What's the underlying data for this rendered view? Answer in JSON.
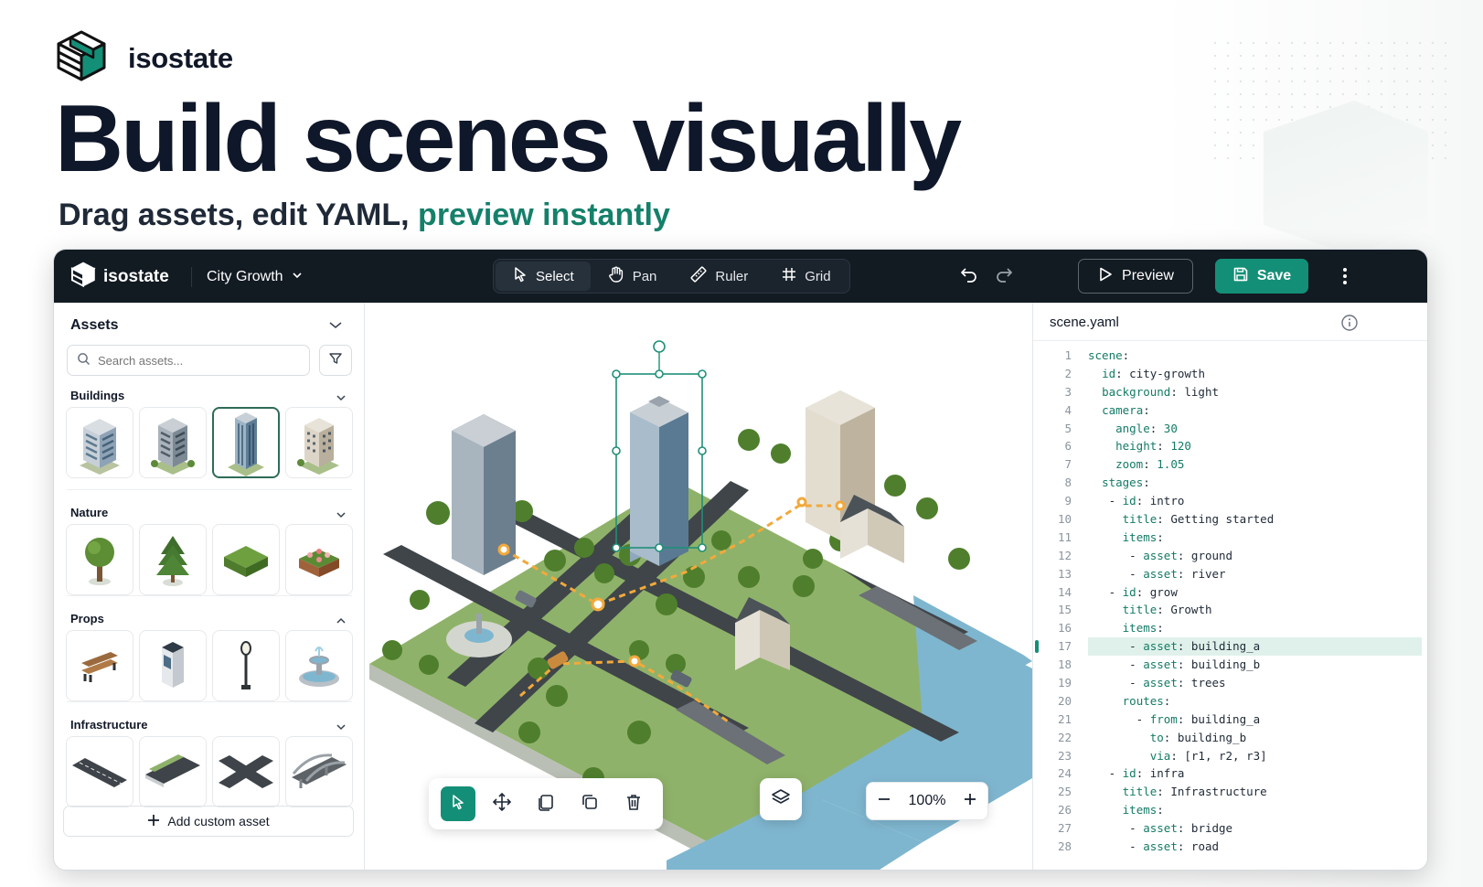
{
  "brand": {
    "name": "isostate"
  },
  "hero": {
    "headline": "Build scenes visually",
    "sub_prefix": "Drag assets, edit YAML, ",
    "sub_accent": "preview instantly"
  },
  "app": {
    "logo_text": "isostate",
    "project": "City Growth",
    "tools": [
      {
        "label": "Select",
        "icon": "cursor-icon",
        "active": true
      },
      {
        "label": "Pan",
        "icon": "hand-icon",
        "active": false
      },
      {
        "label": "Ruler",
        "icon": "ruler-icon",
        "active": false
      },
      {
        "label": "Grid",
        "icon": "grid-icon",
        "active": false
      }
    ],
    "preview_label": "Preview",
    "save_label": "Save"
  },
  "assets": {
    "title": "Assets",
    "search_placeholder": "Search assets...",
    "categories": [
      {
        "name": "Buildings",
        "expanded": true,
        "items": [
          "building-glass",
          "building-office",
          "building-tower",
          "building-apartment"
        ],
        "selected_index": 2
      },
      {
        "name": "Nature",
        "expanded": true,
        "items": [
          "tree-round",
          "tree-pine",
          "hedge",
          "flower-planter"
        ]
      },
      {
        "name": "Props",
        "expanded": true,
        "items": [
          "bench",
          "kiosk",
          "street-lamp",
          "fountain"
        ]
      },
      {
        "name": "Infrastructure",
        "expanded": true,
        "items": [
          "road-straight",
          "road-sidewalk",
          "road-intersection",
          "bridge"
        ]
      }
    ],
    "add_label": "Add custom asset"
  },
  "canvas": {
    "zoom": "100%",
    "bottom_tools": [
      "select-tool",
      "move-tool",
      "duplicate-tool",
      "copy-tool",
      "delete-tool"
    ]
  },
  "yaml": {
    "filename": "scene.yaml",
    "highlight_line": 17,
    "lines": [
      "scene:",
      "  id: city-growth",
      "  background: light",
      "  camera:",
      "    angle: 30",
      "    height: 120",
      "    zoom: 1.05",
      "  stages:",
      "   - id: intro",
      "     title: Getting started",
      "     items:",
      "      - asset: ground",
      "      - asset: river",
      "   - id: grow",
      "     title: Growth",
      "     items:",
      "      - asset: building_a",
      "      - asset: building_b",
      "      - asset: trees",
      "     routes:",
      "       - from: building_a",
      "         to: building_b",
      "         via: [r1, r2, r3]",
      "   - id: infra",
      "     title: Infrastructure",
      "     items:",
      "      - asset: bridge",
      "      - asset: road"
    ]
  },
  "colors": {
    "accent": "#15806a",
    "topbar": "#121a22",
    "save": "#148f77",
    "water": "#7fb6cf",
    "grass": "#8fb26a"
  }
}
